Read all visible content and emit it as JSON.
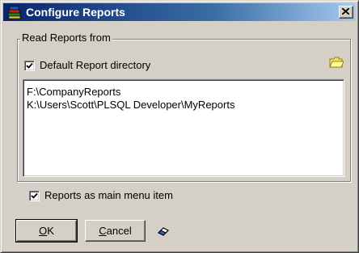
{
  "window": {
    "title": "Configure Reports",
    "title_icon": "books-icon"
  },
  "group": {
    "label": "Read Reports from",
    "default_dir_checkbox": {
      "label": "Default Report directory",
      "checked": true
    },
    "folder_button_icon": "open-folder-icon",
    "directories": [
      "F:\\CompanyReports",
      "K:\\Users\\Scott\\PLSQL Developer\\MyReports"
    ]
  },
  "main_menu_checkbox": {
    "label": "Reports as main menu item",
    "checked": true
  },
  "buttons": {
    "ok": {
      "accel": "O",
      "rest": "K"
    },
    "cancel": {
      "accel": "C",
      "rest": "ancel"
    },
    "clear_icon": "eraser-icon"
  },
  "colors": {
    "titlebar_start": "#0a246a",
    "titlebar_end": "#a6caf0",
    "face": "#d4d0c8"
  }
}
